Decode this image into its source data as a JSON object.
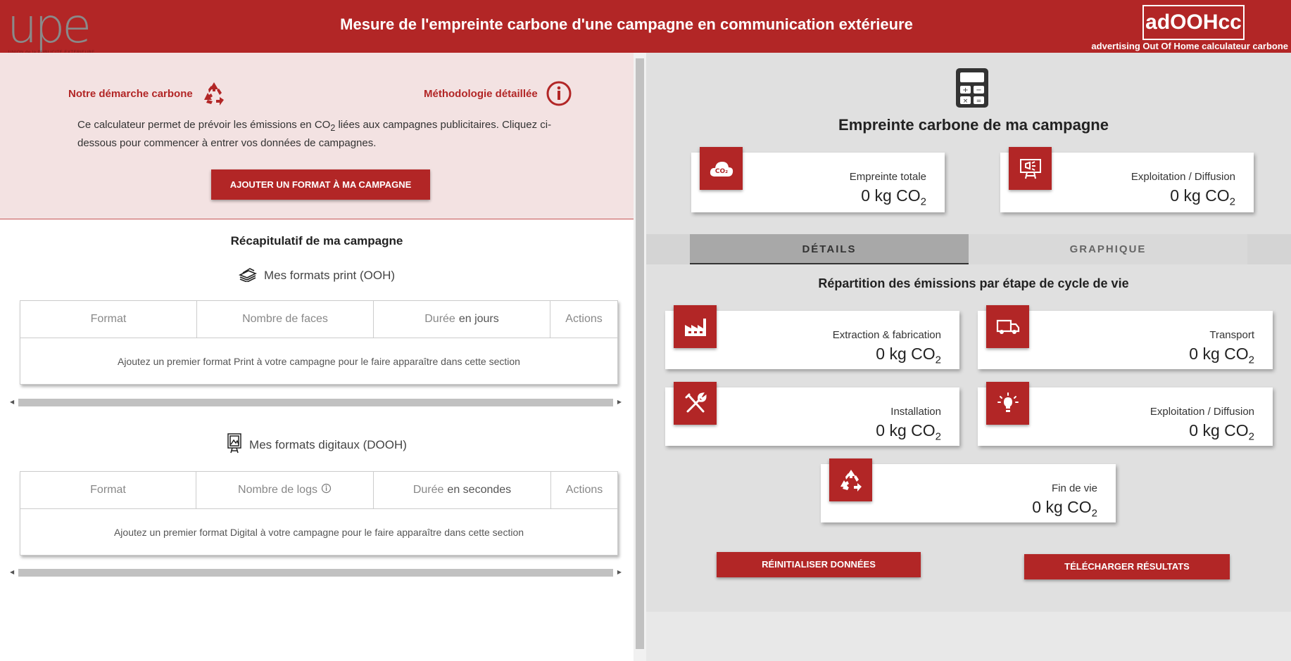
{
  "header": {
    "logo_text": "upe",
    "logo_subtext": "UNION de la PUBLICITE EXTERIEURE",
    "title": "Mesure de l'empreinte carbone d'une campagne en communication extérieure",
    "brand": "adOOHcc",
    "brand_sub": "advertising Out Of Home calculateur carbone"
  },
  "intro": {
    "link_demarche": "Notre démarche carbone",
    "link_methodo": "Méthodologie détaillée",
    "text_before": "Ce calculateur permet de prévoir les émissions en CO",
    "text_sub": "2",
    "text_after": " liées aux campagnes publicitaires. Cliquez ci-dessous pour commencer à entrer vos données de campagnes.",
    "add_button": "AJOUTER UN FORMAT À MA CAMPAGNE"
  },
  "recap": {
    "title": "Récapitulatif de ma campagne",
    "print": {
      "title": "Mes formats print (OOH)",
      "columns": {
        "format": "Format",
        "faces": "Nombre de faces",
        "duree_a": "Durée",
        "duree_b": "en jours",
        "actions": "Actions"
      },
      "empty": "Ajoutez un premier format Print à votre campagne pour le faire apparaître dans cette section"
    },
    "digital": {
      "title": "Mes formats digitaux (DOOH)",
      "columns": {
        "format": "Format",
        "logs": "Nombre de logs",
        "duree_a": "Durée",
        "duree_b": "en secondes",
        "actions": "Actions"
      },
      "empty": "Ajoutez un premier format Digital à votre campagne pour le faire apparaître dans cette section"
    }
  },
  "results": {
    "title": "Empreinte carbone de ma campagne",
    "unit_main": "CO",
    "unit_sub": "2",
    "total": {
      "label": "Empreinte totale",
      "value": "0 kg"
    },
    "exploitation_top": {
      "label": "Exploitation / Diffusion",
      "value": "0 kg"
    },
    "tabs": {
      "details": "DÉTAILS",
      "graph": "GRAPHIQUE"
    },
    "repartition_title": "Répartition des émissions par étape de cycle de vie",
    "extraction": {
      "label": "Extraction & fabrication",
      "value": "0 kg"
    },
    "transport": {
      "label": "Transport",
      "value": "0 kg"
    },
    "installation": {
      "label": "Installation",
      "value": "0 kg"
    },
    "exploitation": {
      "label": "Exploitation / Diffusion",
      "value": "0 kg"
    },
    "fin_de_vie": {
      "label": "Fin de vie",
      "value": "0 kg"
    },
    "reset_button": "RÉINITIALISER DONNÉES",
    "download_button": "TÉLÉCHARGER RÉSULTATS"
  },
  "colors": {
    "accent": "#b22626",
    "intro_bg": "#f3e2e2",
    "right_bg": "#e0e0e0"
  },
  "icons": [
    "recycle-icon",
    "info-icon",
    "print-stack-icon",
    "digital-screen-icon",
    "calculator-icon",
    "co2-cloud-icon",
    "billboard-icon",
    "factory-icon",
    "truck-icon",
    "tools-icon",
    "lightbulb-icon",
    "help-circle-icon"
  ]
}
